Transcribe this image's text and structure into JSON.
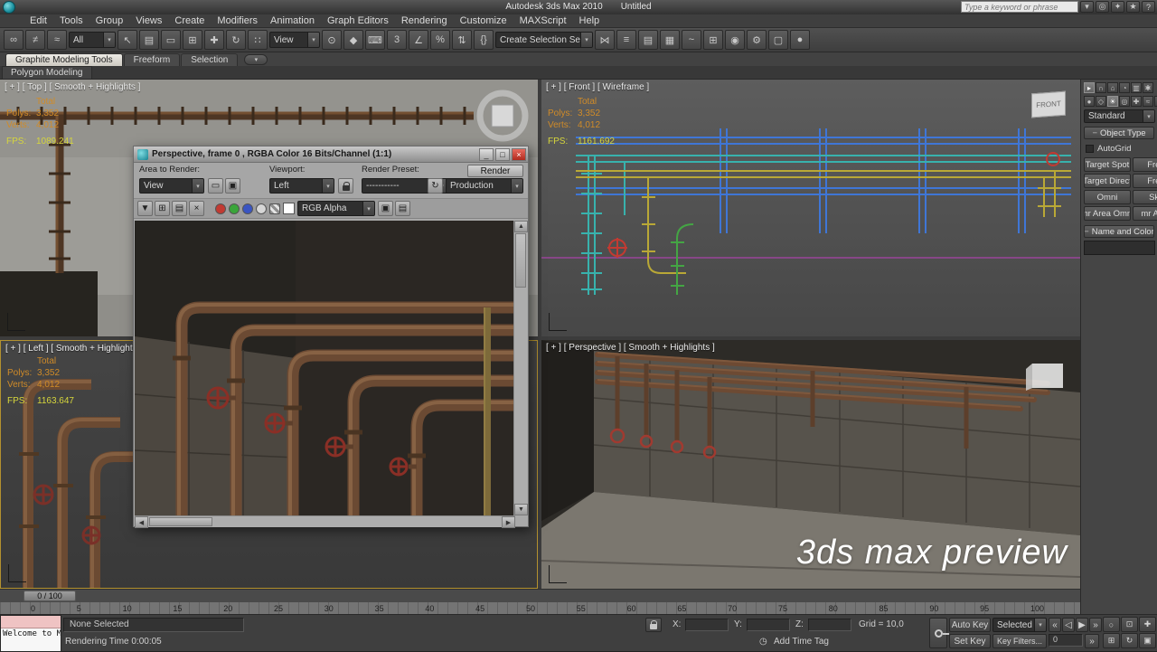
{
  "titlebar": {
    "app_title": "Autodesk 3ds Max 2010",
    "doc_title": "Untitled"
  },
  "infocenter": {
    "search_placeholder": "Type a keyword or phrase",
    "icons": [
      {
        "name": "search-dropdown-icon",
        "glyph": "▾"
      },
      {
        "name": "search-icon",
        "glyph": "◎"
      },
      {
        "name": "communication-center-icon",
        "glyph": "✦"
      },
      {
        "name": "favorites-star-icon",
        "glyph": "★"
      },
      {
        "name": "help-icon",
        "glyph": "?"
      }
    ]
  },
  "menu": {
    "items": [
      "Edit",
      "Tools",
      "Group",
      "Views",
      "Create",
      "Modifiers",
      "Animation",
      "Graph Editors",
      "Rendering",
      "Customize",
      "MAXScript",
      "Help"
    ]
  },
  "main_toolbar": {
    "selection_filter_value": "All",
    "ref_coord_value": "View",
    "named_sets_value": "Create Selection Se",
    "icons_a": [
      {
        "name": "select-and-link-icon",
        "glyph": "∞"
      },
      {
        "name": "unlink-selection-icon",
        "glyph": "≠"
      },
      {
        "name": "bind-to-space-warp-icon",
        "glyph": "≈"
      }
    ],
    "icons_b": [
      {
        "name": "select-object-icon",
        "glyph": "↖"
      },
      {
        "name": "select-by-name-icon",
        "glyph": "▤"
      },
      {
        "name": "rectangular-selection-icon",
        "glyph": "▭"
      },
      {
        "name": "window-crossing-icon",
        "glyph": "⊞"
      },
      {
        "name": "select-and-move-icon",
        "glyph": "✚"
      },
      {
        "name": "select-and-rotate-icon",
        "glyph": "↻"
      },
      {
        "name": "select-and-scale-icon",
        "glyph": "∷"
      }
    ],
    "icons_c": [
      {
        "name": "use-pivot-point-icon",
        "glyph": "⊙"
      },
      {
        "name": "select-and-manipulate-icon",
        "glyph": "◆"
      },
      {
        "name": "keyboard-override-icon",
        "glyph": "⌨"
      },
      {
        "name": "snaps-toggle-icon",
        "glyph": "3"
      },
      {
        "name": "angle-snap-icon",
        "glyph": "∠"
      },
      {
        "name": "percent-snap-icon",
        "glyph": "%"
      },
      {
        "name": "spinner-snap-icon",
        "glyph": "⇅"
      },
      {
        "name": "named-selection-sets-icon",
        "glyph": "{}"
      }
    ],
    "icons_d": [
      {
        "name": "mirror-icon",
        "glyph": "⋈"
      },
      {
        "name": "align-icon",
        "glyph": "≡"
      },
      {
        "name": "layer-manager-icon",
        "glyph": "▤"
      },
      {
        "name": "graphite-ribbon-toggle-icon",
        "glyph": "▦"
      },
      {
        "name": "curve-editor-icon",
        "glyph": "~"
      },
      {
        "name": "schematic-view-icon",
        "glyph": "⊞"
      },
      {
        "name": "material-editor-icon",
        "glyph": "◉"
      },
      {
        "name": "render-setup-icon",
        "glyph": "⚙"
      },
      {
        "name": "rendered-frame-window-icon",
        "glyph": "▢"
      },
      {
        "name": "render-production-icon",
        "glyph": "●"
      }
    ]
  },
  "ribbon": {
    "tabs": [
      {
        "label": "Graphite Modeling Tools"
      },
      {
        "label": "Freeform"
      },
      {
        "label": "Selection"
      }
    ],
    "subtab": "Polygon Modeling"
  },
  "viewports": {
    "top": {
      "label": "[ + ] [ Top ] [ Smooth + Highlights ]",
      "stats": {
        "total_label": "Total",
        "polys_label": "Polys:",
        "polys": "3,352",
        "verts_label": "Verts:",
        "verts": "4,012",
        "fps_label": "FPS:",
        "fps": "1089.241"
      }
    },
    "front": {
      "label": "[ + ] [ Front ] [ Wireframe ]",
      "viewcube_label": "FRONT",
      "stats": {
        "total_label": "Total",
        "polys_label": "Polys:",
        "polys": "3,352",
        "verts_label": "Verts:",
        "verts": "4,012",
        "fps_label": "FPS:",
        "fps": "1161.692"
      }
    },
    "left": {
      "label": "[ + ] [ Left ] [ Smooth + Highlights ]",
      "stats": {
        "total_label": "Total",
        "polys_label": "Polys:",
        "polys": "3,352",
        "verts_label": "Verts:",
        "verts": "4,012",
        "fps_label": "FPS:",
        "fps": "1163.647"
      }
    },
    "perspective": {
      "label": "[ + ] [ Perspective ] [ Smooth + Highlights ]",
      "watermark": "3ds max preview"
    }
  },
  "render_window": {
    "title": "Perspective, frame 0 , RGBA Color 16 Bits/Channel (1:1)",
    "window_buttons": [
      {
        "name": "minimize-button",
        "glyph": "_"
      },
      {
        "name": "restore-button",
        "glyph": "□"
      },
      {
        "name": "close-button",
        "glyph": "×"
      }
    ],
    "area_to_render_label": "Area to Render:",
    "area_to_render_value": "View",
    "viewport_label": "Viewport:",
    "viewport_value": "Left",
    "render_preset_label": "Render Preset:",
    "render_preset_value": "-----------",
    "render_button_label": "Render",
    "render_mode_value": "Production",
    "channel_value": "RGB Alpha",
    "tb1_icons": [
      {
        "name": "edit-region-icon",
        "glyph": "▭"
      },
      {
        "name": "auto-region-icon",
        "glyph": "▣"
      },
      {
        "name": "render-history-icon",
        "glyph": "↻"
      }
    ],
    "toolbar_icons": [
      {
        "name": "save-image-icon",
        "glyph": "▼"
      },
      {
        "name": "clone-window-icon",
        "glyph": "⊞"
      },
      {
        "name": "print-image-icon",
        "glyph": "▤"
      },
      {
        "name": "clear-image-icon",
        "glyph": "×"
      }
    ],
    "right_icons": [
      {
        "name": "vfb-extra-button-1",
        "glyph": "▣"
      },
      {
        "name": "vfb-extra-button-2",
        "glyph": "▤"
      }
    ]
  },
  "command_panel": {
    "tabs": [
      {
        "name": "create-tab-icon",
        "glyph": "▸"
      },
      {
        "name": "modify-tab-icon",
        "glyph": "∩"
      },
      {
        "name": "hierarchy-tab-icon",
        "glyph": "⌂"
      },
      {
        "name": "motion-tab-icon",
        "glyph": "◔"
      },
      {
        "name": "display-tab-icon",
        "glyph": "▥"
      },
      {
        "name": "utilities-tab-icon",
        "glyph": "✱"
      }
    ],
    "categories": [
      {
        "name": "geometry-category-icon",
        "glyph": "●"
      },
      {
        "name": "shapes-category-icon",
        "glyph": "◇"
      },
      {
        "name": "lights-category-icon",
        "glyph": "☀"
      },
      {
        "name": "cameras-category-icon",
        "glyph": "◎"
      },
      {
        "name": "helpers-category-icon",
        "glyph": "✚"
      },
      {
        "name": "space-warps-category-icon",
        "glyph": "≈"
      },
      {
        "name": "systems-category-icon",
        "glyph": "⚙"
      }
    ],
    "dropdown_value": "Standard",
    "object_type_label": "Object Type",
    "autogrid_label": "AutoGrid",
    "light_buttons": [
      "Target Spot",
      "Free",
      "Target Direct",
      "Free",
      "Omni",
      "Sky",
      "mr Area Omni",
      "mr Area"
    ],
    "name_color_label": "Name and Color"
  },
  "timeline": {
    "slider_value": "0 / 100",
    "ticks": [
      "0",
      "5",
      "10",
      "15",
      "20",
      "25",
      "30",
      "35",
      "40",
      "45",
      "50",
      "55",
      "60",
      "65",
      "70",
      "75",
      "80",
      "85",
      "90",
      "95",
      "100"
    ]
  },
  "status_bar": {
    "listener_text": "Welcome to M.",
    "prompt": "None Selected",
    "rendering_time": "Rendering Time 0:00:05",
    "x_label": "X:",
    "y_label": "Y:",
    "z_label": "Z:",
    "grid_label": "Grid = 10,0",
    "clock_glyph": "◷",
    "add_time_tag": "Add Time Tag",
    "auto_key_label": "Auto Key",
    "set_key_label": "Set Key",
    "selected_value": "Selected",
    "key_filters_label": "Key Filters...",
    "frame_field_value": "0",
    "playback_icons": [
      {
        "name": "go-to-start-button",
        "glyph": "«"
      },
      {
        "name": "previous-frame-button",
        "glyph": "◁"
      },
      {
        "name": "play-button",
        "glyph": "▶"
      },
      {
        "name": "go-to-end-button",
        "glyph": "»"
      }
    ],
    "nav_icons": [
      {
        "name": "zoom-icon",
        "glyph": "○"
      },
      {
        "name": "zoom-extents-icon",
        "glyph": "⊡"
      },
      {
        "name": "pan-icon",
        "glyph": "✚"
      },
      {
        "name": "zoom-region-icon",
        "glyph": "⊞"
      },
      {
        "name": "orbit-icon",
        "glyph": "↻"
      },
      {
        "name": "maximize-viewport-toggle-icon",
        "glyph": "▣"
      }
    ]
  },
  "colors": {
    "active_viewport_border": "#b3912f",
    "stats_text": "#d08b28",
    "fps_text": "#d6d63c",
    "wire_blue": "#3f76d6",
    "wire_teal": "#38b2ad",
    "wire_yellow": "#b9a836",
    "wire_green": "#44a544",
    "wire_red": "#c23a32",
    "grid_magenta": "#c040c0"
  }
}
